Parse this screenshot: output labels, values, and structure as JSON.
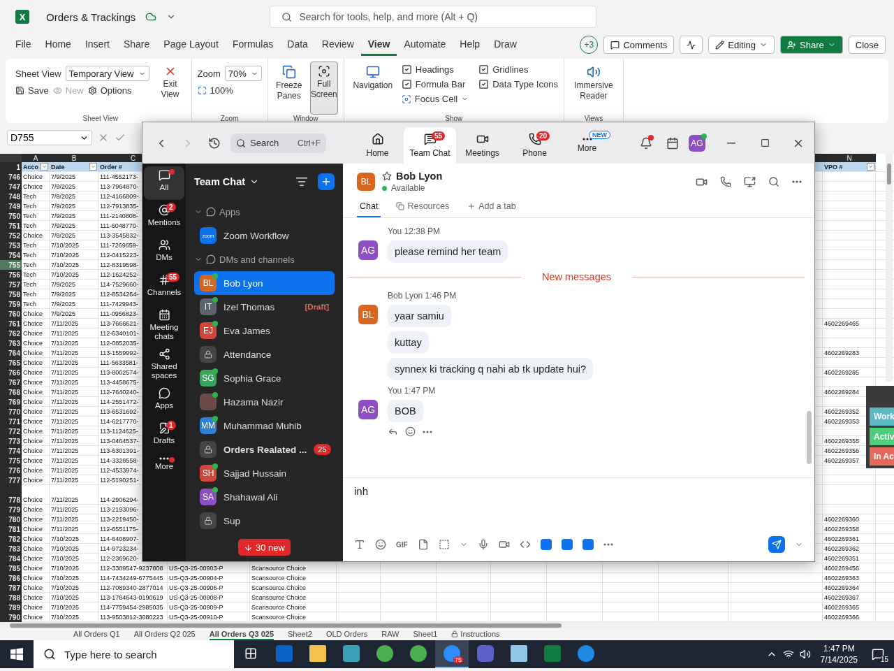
{
  "excel": {
    "title": "Orders & Trackings",
    "logo": "X",
    "search_placeholder": "Search for tools, help, and more (Alt + Q)",
    "menu": [
      {
        "label": "File",
        "selected": false
      },
      {
        "label": "Home",
        "selected": false
      },
      {
        "label": "Insert",
        "selected": false
      },
      {
        "label": "Share",
        "selected": false
      },
      {
        "label": "Page Layout",
        "selected": false
      },
      {
        "label": "Formulas",
        "selected": false
      },
      {
        "label": "Data",
        "selected": false
      },
      {
        "label": "Review",
        "selected": false
      },
      {
        "label": "View",
        "selected": true
      },
      {
        "label": "Automate",
        "selected": false
      },
      {
        "label": "Help",
        "selected": false
      },
      {
        "label": "Draw",
        "selected": false
      }
    ],
    "collaborators": "+3",
    "comments": "Comments",
    "editing": "Editing",
    "share": "Share",
    "close": "Close",
    "ribbon": {
      "sheet_view": {
        "label": "Sheet View",
        "dropdown": "Temporary View",
        "save": "Save",
        "new": "New",
        "new_disabled": true,
        "options": "Options",
        "exit": "Exit View",
        "group": "Sheet View"
      },
      "zoom": {
        "label": "Zoom",
        "value": "70%",
        "reset": "100%",
        "group": "Zoom"
      },
      "window": {
        "freeze": "Freeze Panes",
        "full": "Full Screen",
        "full_pressed": true,
        "group": "Window"
      },
      "navigation": "Navigation",
      "show": {
        "options": [
          {
            "label": "Headings",
            "checked": true
          },
          {
            "label": "Gridlines",
            "checked": true
          },
          {
            "label": "Formula Bar",
            "checked": true
          },
          {
            "label": "Data Type Icons",
            "checked": true
          }
        ],
        "focus_cell": "Focus Cell",
        "group": "Show"
      },
      "views": {
        "reader": "Immersive Reader",
        "group": "Views"
      }
    },
    "name_box": "D755",
    "col_headers": {
      "a": "A",
      "b": "B",
      "c": "C",
      "n": "N"
    },
    "header_row": {
      "num": "1",
      "a": "Acco",
      "b": "Date",
      "c": "Order #",
      "n": "VPO #"
    },
    "rows": [
      {
        "num": "746",
        "a": "Choice",
        "b": "7/9/2025",
        "c": "111-4552173-",
        "selected": false,
        "tall": false
      },
      {
        "num": "747",
        "a": "Choice",
        "b": "7/9/2025",
        "c": "113-7964870-",
        "selected": false,
        "tall": false
      },
      {
        "num": "748",
        "a": "Tech",
        "b": "7/9/2025",
        "c": "112-4166809-",
        "selected": false,
        "tall": false
      },
      {
        "num": "749",
        "a": "Tech",
        "b": "7/9/2025",
        "c": "112-7913835-",
        "selected": false,
        "tall": false
      },
      {
        "num": "750",
        "a": "Tech",
        "b": "7/9/2025",
        "c": "111-2140808-",
        "selected": false,
        "tall": false
      },
      {
        "num": "751",
        "a": "Tech",
        "b": "7/9/2025",
        "c": "111-6048770-",
        "selected": false,
        "tall": false
      },
      {
        "num": "752",
        "a": "Choice",
        "b": "7/9/2025",
        "c": "113-3545832-",
        "selected": false,
        "tall": false
      },
      {
        "num": "753",
        "a": "Tech",
        "b": "7/10/2025",
        "c": "111-7269659-",
        "selected": false,
        "tall": false
      },
      {
        "num": "754",
        "a": "Tech",
        "b": "7/10/2025",
        "c": "112-0415223-",
        "selected": false,
        "tall": false
      },
      {
        "num": "755",
        "a": "Tech",
        "b": "7/10/2025",
        "c": "112-8319598-",
        "selected": true,
        "tall": false
      },
      {
        "num": "756",
        "a": "Tech",
        "b": "7/10/2025",
        "c": "112-1624252-",
        "selected": false,
        "tall": false
      },
      {
        "num": "757",
        "a": "Tech",
        "b": "7/9/2025",
        "c": "114-7529660-",
        "selected": false,
        "tall": false
      },
      {
        "num": "758",
        "a": "Tech",
        "b": "7/9/2025",
        "c": "112-8534264-",
        "selected": false,
        "tall": false
      },
      {
        "num": "759",
        "a": "Tech",
        "b": "7/9/2025",
        "c": "111-7429943-",
        "selected": false,
        "tall": false
      },
      {
        "num": "760",
        "a": "Choice",
        "b": "7/9/2025",
        "c": "111-0956823-",
        "selected": false,
        "tall": false
      },
      {
        "num": "761",
        "a": "Choice",
        "b": "7/11/2025",
        "c": "113-7666621-",
        "n": "4602269465",
        "selected": false,
        "tall": false
      },
      {
        "num": "762",
        "a": "Choice",
        "b": "7/11/2025",
        "c": "112-6340101-",
        "selected": false,
        "tall": false
      },
      {
        "num": "763",
        "a": "Choice",
        "b": "7/11/2025",
        "c": "112-0852035-",
        "selected": false,
        "tall": false
      },
      {
        "num": "764",
        "a": "Choice",
        "b": "7/11/2025",
        "c": "113-1559992-",
        "n": "4602269283",
        "selected": false,
        "tall": false
      },
      {
        "num": "765",
        "a": "Choice",
        "b": "7/11/2025",
        "c": "111-5633581-",
        "selected": false,
        "tall": false
      },
      {
        "num": "766",
        "a": "Choice",
        "b": "7/11/2025",
        "c": "113-8002574-",
        "n": "4602269285",
        "selected": false,
        "tall": false
      },
      {
        "num": "767",
        "a": "Choice",
        "b": "7/11/2025",
        "c": "113-4458675-",
        "selected": false,
        "tall": false
      },
      {
        "num": "768",
        "a": "Choice",
        "b": "7/11/2025",
        "c": "112-7640240-",
        "n": "4602269284",
        "selected": false,
        "tall": false
      },
      {
        "num": "769",
        "a": "Choice",
        "b": "7/11/2025",
        "c": "114-2551472-",
        "selected": false,
        "tall": false
      },
      {
        "num": "770",
        "a": "Choice",
        "b": "7/11/2025",
        "c": "113-6531692-",
        "n": "4602269352",
        "selected": false,
        "tall": false
      },
      {
        "num": "771",
        "a": "Choice",
        "b": "7/11/2025",
        "c": "114-6217770-",
        "n": "4602269353",
        "selected": false,
        "tall": false
      },
      {
        "num": "772",
        "a": "Choice",
        "b": "7/11/2025",
        "c": "113-1124625-",
        "selected": false,
        "tall": false
      },
      {
        "num": "773",
        "a": "Choice",
        "b": "7/11/2025",
        "c": "113-0464537-",
        "n": "4602269355",
        "selected": false,
        "tall": false
      },
      {
        "num": "774",
        "a": "Choice",
        "b": "7/11/2025",
        "c": "113-6301391-",
        "n": "4602269356",
        "selected": false,
        "tall": false
      },
      {
        "num": "775",
        "a": "Choice",
        "b": "7/11/2025",
        "c": "114-3328558-",
        "n": "4602269357",
        "selected": false,
        "tall": false
      },
      {
        "num": "776",
        "a": "Choice",
        "b": "7/11/2025",
        "c": "112-4533974-",
        "selected": false,
        "tall": false
      },
      {
        "num": "777",
        "a": "Choice",
        "b": "7/11/2025",
        "c": "112-5190251-",
        "selected": false,
        "tall": false
      },
      {
        "num": "778",
        "a": "Choice",
        "b": "7/11/2025",
        "c": "114-2906294-",
        "selected": false,
        "tall": true
      },
      {
        "num": "779",
        "a": "Choice",
        "b": "7/11/2025",
        "c": "113-2193096-",
        "selected": false,
        "tall": false
      },
      {
        "num": "780",
        "a": "Choice",
        "b": "7/11/2025",
        "c": "113-2219450-",
        "n": "4602269360",
        "selected": false,
        "tall": false
      },
      {
        "num": "781",
        "a": "Choice",
        "b": "7/11/2025",
        "c": "112-6551175-",
        "n": "4602269358",
        "selected": false,
        "tall": false
      },
      {
        "num": "782",
        "a": "Choice",
        "b": "7/10/2025",
        "c": "114-6408907-",
        "n": "4602269361",
        "selected": false,
        "tall": false
      },
      {
        "num": "783",
        "a": "Choice",
        "b": "7/10/2025",
        "c": "114-9723234-",
        "n": "4602269362",
        "selected": false,
        "tall": false
      },
      {
        "num": "784",
        "a": "Choice",
        "b": "7/10/2025",
        "c": "112-2369620-",
        "n": "4602269351",
        "selected": false,
        "tall": false
      },
      {
        "num": "785",
        "a": "Choice",
        "b": "7/10/2025",
        "c": "112-3389547-9237808",
        "d": "US-Q3-25-00903-P",
        "e": "Scansource Choice",
        "n": "4602269456",
        "selected": false,
        "tall": false
      },
      {
        "num": "786",
        "a": "Choice",
        "b": "7/10/2025",
        "c": "114-7434249-6775445",
        "d": "US-Q3-25-00904-P",
        "e": "Scansource Choice",
        "n": "4602269363",
        "selected": false,
        "tall": false
      },
      {
        "num": "787",
        "a": "Choice",
        "b": "7/10/2025",
        "c": "112-7089340-2877014",
        "d": "US-Q3-25-00906-P",
        "e": "Scansource Choice",
        "n": "4602269364",
        "selected": false,
        "tall": false
      },
      {
        "num": "788",
        "a": "Choice",
        "b": "7/10/2025",
        "c": "113-1784643-0190619",
        "d": "US-Q3-25-00908-P",
        "e": "Scansource Choice",
        "n": "4602269367",
        "selected": false,
        "tall": false
      },
      {
        "num": "789",
        "a": "Choice",
        "b": "7/10/2025",
        "c": "114-7759454-2985035",
        "d": "US-Q3-25-00909-P",
        "e": "Scansource Choice",
        "n": "4602269365",
        "selected": false,
        "tall": false
      },
      {
        "num": "790",
        "a": "Choice",
        "b": "7/10/2025",
        "c": "113-9503812-3080223",
        "d": "US-Q3-25-00910-P",
        "e": "Scansource Choice",
        "n": "4602269366",
        "selected": false,
        "tall": false
      }
    ],
    "sheet_tabs": [
      {
        "label": "All Orders Q1",
        "selected": false,
        "locked": false
      },
      {
        "label": "All Orders Q2 025",
        "selected": false,
        "locked": false
      },
      {
        "label": "All Orders Q3 025",
        "selected": true,
        "locked": false
      },
      {
        "label": "Sheet2",
        "selected": false,
        "locked": false
      },
      {
        "label": "OLD Orders",
        "selected": false,
        "locked": false
      },
      {
        "label": "RAW",
        "selected": false,
        "locked": false
      },
      {
        "label": "Sheet1",
        "selected": false,
        "locked": false
      },
      {
        "label": "Instructions",
        "selected": false,
        "locked": true
      }
    ],
    "status_panel": [
      {
        "label": "Work",
        "color": "#5bb8c4"
      },
      {
        "label": "Activ",
        "color": "#4ccf7a"
      },
      {
        "label": "In Ac",
        "color": "#e8685a"
      }
    ]
  },
  "zoom": {
    "search_placeholder": "Search",
    "shortcut": "Ctrl+F",
    "tabs": [
      {
        "kind": "home",
        "label": "Home",
        "selected": false
      },
      {
        "kind": "chat",
        "label": "Team Chat",
        "badge": "55",
        "selected": true
      },
      {
        "kind": "meetings",
        "label": "Meetings",
        "selected": false
      },
      {
        "kind": "phone",
        "label": "Phone",
        "badge": "20",
        "selected": false
      },
      {
        "kind": "more",
        "label": "More",
        "tag": "NEW",
        "selected": false
      }
    ],
    "bell_dot": true,
    "avatar": "AG",
    "avatar_online": true,
    "rail": [
      {
        "kind": "all",
        "label": "All",
        "dot": true,
        "selected": true
      },
      {
        "kind": "mentions",
        "label": "Mentions",
        "badge": "2",
        "dot": false,
        "selected": false
      },
      {
        "kind": "dms",
        "label": "DMs",
        "dot": false,
        "selected": false
      },
      {
        "kind": "channels",
        "label": "Channels",
        "badge": "55",
        "dot": false,
        "selected": false
      },
      {
        "kind": "meeting",
        "label": "Meeting chats",
        "dot": false,
        "selected": false
      },
      {
        "kind": "shared",
        "label": "Shared spaces",
        "dot": false,
        "selected": false
      },
      {
        "kind": "apps",
        "label": "Apps",
        "dot": false,
        "selected": false
      },
      {
        "kind": "drafts",
        "label": "Drafts",
        "badge": "1",
        "dot": false,
        "selected": false
      },
      {
        "kind": "more",
        "label": "More",
        "dot": true,
        "selected": false
      }
    ],
    "sidebar": {
      "title": "Team Chat",
      "sections": [
        {
          "label": "Apps",
          "expanded": true,
          "items": [
            {
              "kind": "app",
              "logo": "zoom",
              "name": "Zoom Workflow",
              "selected": false,
              "bold": false
            }
          ]
        },
        {
          "label": "DMs and channels",
          "expanded": true,
          "items": [
            {
              "kind": "avatar",
              "initials": "BL",
              "color": "#d9661f",
              "online": true,
              "name": "Bob Lyon",
              "selected": true,
              "bold": false
            },
            {
              "kind": "avatar",
              "initials": "IT",
              "color": "#5c6470",
              "online": true,
              "name": "Izel Thomas",
              "tag": "[Draft]",
              "selected": false,
              "bold": false
            },
            {
              "kind": "avatar",
              "initials": "EJ",
              "color": "#d2473a",
              "online": true,
              "name": "Eva James",
              "selected": false,
              "bold": false
            },
            {
              "kind": "lock",
              "name": "Attendance",
              "selected": false,
              "bold": false
            },
            {
              "kind": "avatar",
              "initials": "SG",
              "color": "#3aa55a",
              "online": true,
              "name": "Sophia Grace",
              "selected": false,
              "bold": false
            },
            {
              "kind": "photo",
              "online": true,
              "name": "Hazama Nazir",
              "selected": false,
              "bold": false
            },
            {
              "kind": "avatar",
              "initials": "MM",
              "color": "#2f7fd8",
              "online": true,
              "name": "Muhammad Muhib",
              "selected": false,
              "bold": false
            },
            {
              "kind": "lock",
              "name": "Orders Realated ...",
              "badge": "25",
              "selected": false,
              "bold": true
            },
            {
              "kind": "avatar",
              "initials": "SH",
              "color": "#d2473a",
              "online": true,
              "name": "Sajjad Hussain",
              "selected": false,
              "bold": false
            },
            {
              "kind": "avatar",
              "initials": "SA",
              "color": "#8e4fc4",
              "online": true,
              "name": "Shahawal Ali",
              "selected": false,
              "bold": false
            },
            {
              "kind": "lock",
              "name": "Sup",
              "selected": false,
              "bold": false
            }
          ]
        }
      ],
      "new_pill": "30 new"
    },
    "chat": {
      "initials": "BL",
      "color": "#d9661f",
      "name": "Bob Lyon",
      "status": "Available",
      "tabs": [
        {
          "label": "Chat",
          "selected": true
        },
        {
          "label": "Resources",
          "selected": false
        },
        {
          "label": "Add a tab",
          "selected": false
        }
      ],
      "messages": [
        {
          "kind": "group",
          "initials": "AG",
          "color": "#8e4fc4",
          "sender": "You",
          "time": "12:38 PM",
          "bubbles": [
            "please remind her team"
          ]
        },
        {
          "kind": "divider",
          "label": "New messages"
        },
        {
          "kind": "group",
          "initials": "BL",
          "color": "#d9661f",
          "sender": "Bob Lyon",
          "time": "1:46 PM",
          "bubbles": [
            "yaar samiu",
            "kuttay",
            "synnex ki tracking q nahi ab tk update hui?"
          ]
        },
        {
          "kind": "group",
          "initials": "AG",
          "color": "#8e4fc4",
          "sender": "You",
          "time": "1:47 PM",
          "bubbles": [
            "BOB"
          ],
          "actions": true
        }
      ],
      "compose_value": "inh",
      "tools": [
        {
          "kind": "format"
        },
        {
          "kind": "emoji"
        },
        {
          "kind": "gif",
          "label": "GIF"
        },
        {
          "kind": "file"
        },
        {
          "kind": "screenshot"
        },
        {
          "kind": "caret"
        },
        {
          "kind": "audio"
        },
        {
          "kind": "video"
        },
        {
          "kind": "code"
        },
        {
          "kind": "app"
        },
        {
          "kind": "app"
        },
        {
          "kind": "app"
        },
        {
          "kind": "more"
        }
      ]
    }
  },
  "taskbar": {
    "search_placeholder": "Type here to search",
    "apps": [
      {
        "kind": "taskview",
        "selected": false
      },
      {
        "kind": "outlook",
        "selected": false
      },
      {
        "kind": "folder",
        "selected": false
      },
      {
        "kind": "diamond",
        "selected": false
      },
      {
        "kind": "chrome",
        "selected": false
      },
      {
        "kind": "chrome",
        "selected": false
      },
      {
        "kind": "zoom",
        "badge": "75",
        "selected": true
      },
      {
        "kind": "teams",
        "selected": false
      },
      {
        "kind": "notepad",
        "selected": false
      },
      {
        "kind": "excel",
        "selected": false
      },
      {
        "kind": "round",
        "selected": false
      }
    ],
    "time": "1:47 PM",
    "date": "7/14/2025",
    "notifications": "15"
  }
}
